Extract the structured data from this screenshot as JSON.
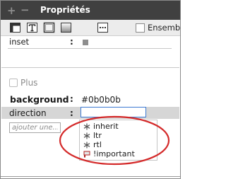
{
  "header": {
    "plus": "+",
    "minus": "−",
    "title": "Propriétés"
  },
  "toolbar": {
    "ensemble_label": "Ensemble",
    "ensemble_checked": false,
    "icons": [
      "layout-icon",
      "text-icon",
      "border-icon",
      "background-icon",
      "more-icon"
    ]
  },
  "properties": {
    "inset": {
      "name": "inset",
      "colon": ":",
      "color": "#8e8e8e"
    },
    "plus_label": "Plus",
    "background": {
      "name": "background",
      "colon": ":",
      "value": "#0b0b0b"
    },
    "direction": {
      "name": "direction",
      "colon": ":",
      "value": ""
    },
    "add_placeholder": "ajouter une..."
  },
  "dropdown": {
    "items": [
      {
        "label": "inherit",
        "icon": "asterisk-icon"
      },
      {
        "label": "ltr",
        "icon": "asterisk-icon"
      },
      {
        "label": "rtl",
        "icon": "asterisk-icon"
      },
      {
        "label": "!important",
        "icon": "flag-icon"
      }
    ]
  },
  "annotation": {
    "color": "#d42a2a"
  }
}
